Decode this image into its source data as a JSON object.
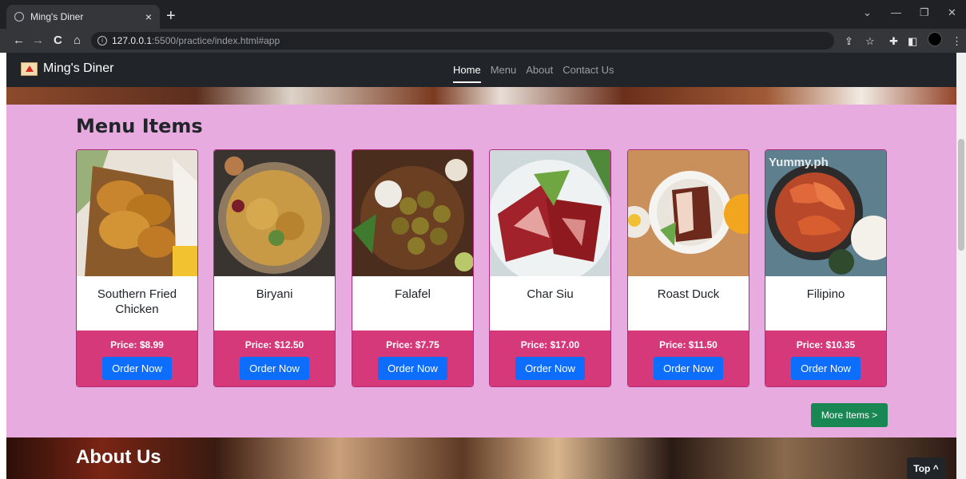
{
  "browser": {
    "tab_title": "Ming's Diner",
    "tab_close": "×",
    "new_tab": "+",
    "url_host": "127.0.0.1",
    "url_path": ":5500/practice/index.html#app",
    "back": "←",
    "forward": "→",
    "reload": "C",
    "home": "⌂",
    "window_controls": {
      "minimize": "—",
      "restore": "❐",
      "close": "✕",
      "tab_search": "⌄"
    }
  },
  "navbar": {
    "brand": "Ming's Diner",
    "links": [
      "Home",
      "Menu",
      "About",
      "Contact Us"
    ],
    "active": "Home"
  },
  "menu": {
    "title": "Menu Items",
    "items": [
      {
        "name": "Southern Fried Chicken",
        "price": "Price: $8.99",
        "button": "Order Now"
      },
      {
        "name": "Biryani",
        "price": "Price: $12.50",
        "button": "Order Now"
      },
      {
        "name": "Falafel",
        "price": "Price: $7.75",
        "button": "Order Now"
      },
      {
        "name": "Char Siu",
        "price": "Price: $17.00",
        "button": "Order Now"
      },
      {
        "name": "Roast Duck",
        "price": "Price: $11.50",
        "button": "Order Now"
      },
      {
        "name": "Filipino",
        "price": "Price: $10.35",
        "button": "Order Now"
      }
    ],
    "more_button": "More Items >",
    "watermark": "Yummy.ph"
  },
  "about": {
    "title": "About Us"
  },
  "top_button": "Top ^",
  "colors": {
    "menu_bg": "#e8abdf",
    "card_footer": "#d6397a",
    "order_button": "#0d6efd",
    "more_button": "#198754",
    "navbar": "#212529"
  }
}
